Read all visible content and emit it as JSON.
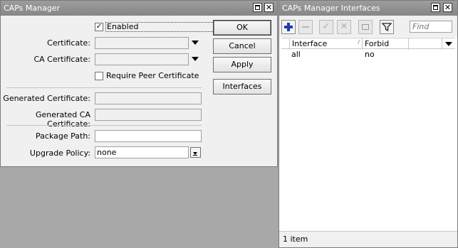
{
  "caps_manager": {
    "title": "CAPs Manager",
    "enabled_label": "Enabled",
    "enabled_checked": true,
    "certificate_label": "Certificate:",
    "certificate_value": "",
    "ca_certificate_label": "CA Certificate:",
    "ca_certificate_value": "",
    "require_peer_label": "Require Peer Certificate",
    "require_peer_checked": false,
    "generated_certificate_label": "Generated Certificate:",
    "generated_certificate_value": "",
    "generated_ca_certificate_label": "Generated CA Certificate:",
    "generated_ca_certificate_value": "",
    "package_path_label": "Package Path:",
    "package_path_value": "",
    "upgrade_policy_label": "Upgrade Policy:",
    "upgrade_policy_value": "none",
    "buttons": {
      "ok": "OK",
      "cancel": "Cancel",
      "apply": "Apply",
      "interfaces": "Interfaces"
    }
  },
  "interfaces_window": {
    "title": "CAPs Manager Interfaces",
    "find_placeholder": "Find",
    "columns": [
      "Interface",
      "Forbid"
    ],
    "rows": [
      {
        "interface": "all",
        "forbid": "no"
      }
    ],
    "status": "1 item"
  },
  "colors": {
    "titlebar": "#8e8e8e",
    "add_icon": "#1b3fa8",
    "desktop": "#a8a8a8"
  }
}
